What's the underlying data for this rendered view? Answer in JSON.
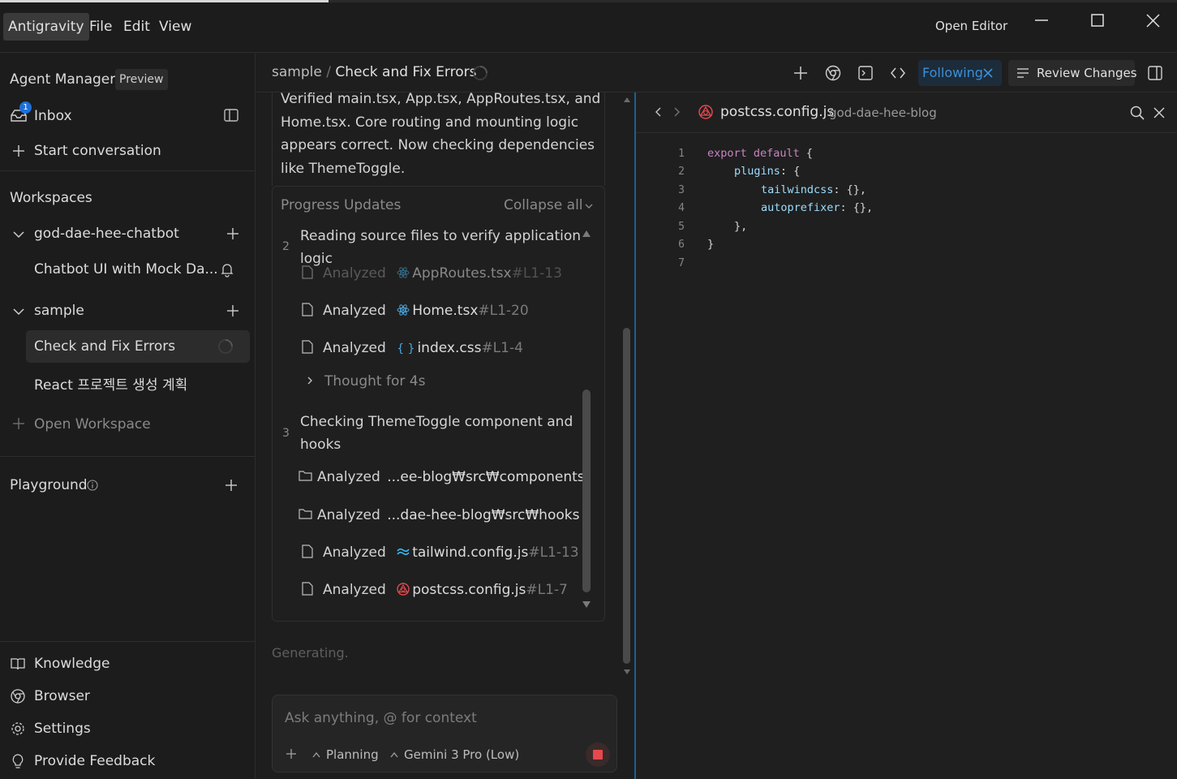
{
  "window": {
    "menu": [
      "Antigravity",
      "File",
      "Edit",
      "View"
    ],
    "open_editor": "Open Editor"
  },
  "sidebar": {
    "agent_manager": "Agent Manager",
    "preview_badge": "Preview",
    "inbox": "Inbox",
    "inbox_count": "1",
    "start_conversation": "Start conversation",
    "workspaces": "Workspaces",
    "workspace1": {
      "name": "god-dae-hee-chatbot",
      "items": [
        "Chatbot UI with Mock Da..."
      ]
    },
    "workspace2": {
      "name": "sample",
      "items": [
        "Check and Fix Errors",
        "React 프로젝트 생성 계획"
      ]
    },
    "open_workspace": "Open Workspace",
    "playground": "Playground",
    "bottom": [
      "Knowledge",
      "Browser",
      "Settings",
      "Provide Feedback"
    ]
  },
  "header": {
    "breadcrumb_root": "sample",
    "breadcrumb_sep": "/",
    "title": "Check and Fix Errors",
    "following": "Following",
    "review_changes": "Review Changes"
  },
  "chat": {
    "summary_lines": [
      "Verified main.tsx, App.tsx, AppRoutes.tsx, and",
      "Home.tsx. Core routing and mounting logic",
      "appears correct. Now checking dependencies",
      "like ThemeToggle."
    ],
    "progress_updates": "Progress Updates",
    "collapse_all": "Collapse all",
    "step2": {
      "num": "2",
      "title_lines": [
        "Reading source files to verify application",
        "logic"
      ]
    },
    "step2_items": [
      {
        "verb": "Analyzed",
        "file": "AppRoutes.tsx",
        "range": "#L1-13"
      },
      {
        "verb": "Analyzed",
        "file": "Home.tsx",
        "range": "#L1-20"
      },
      {
        "verb": "Analyzed",
        "file": "index.css",
        "range": "#L1-4"
      }
    ],
    "thought": "Thought for 4s",
    "step3": {
      "num": "3",
      "title_lines": [
        "Checking ThemeToggle component and",
        "hooks"
      ]
    },
    "step3_items": [
      {
        "verb": "Analyzed",
        "file": "...ee-blog₩src₩components",
        "range": ""
      },
      {
        "verb": "Analyzed",
        "file": "...dae-hee-blog₩src₩hooks",
        "range": ""
      },
      {
        "verb": "Analyzed",
        "file": "tailwind.config.js",
        "range": "#L1-13"
      },
      {
        "verb": "Analyzed",
        "file": "postcss.config.js",
        "range": "#L1-7"
      }
    ],
    "generating": "Generating.",
    "input_placeholder": "Ask anything, @ for context",
    "mode": "Planning",
    "model": "Gemini 3 Pro (Low)"
  },
  "editor": {
    "filename": "postcss.config.js",
    "project": "god-dae-hee-blog",
    "line_numbers": [
      "1",
      "2",
      "3",
      "4",
      "5",
      "6",
      "7"
    ],
    "code": {
      "l1_kw": "export default",
      "l1_rest": " {",
      "l2_prop": "plugins",
      "l2_rest": ": {",
      "l3_prop": "tailwindcss",
      "l3_rest": ": {},",
      "l4_prop": "autoprefixer",
      "l4_rest": ": {},",
      "l5": "},",
      "l6": "}"
    }
  }
}
